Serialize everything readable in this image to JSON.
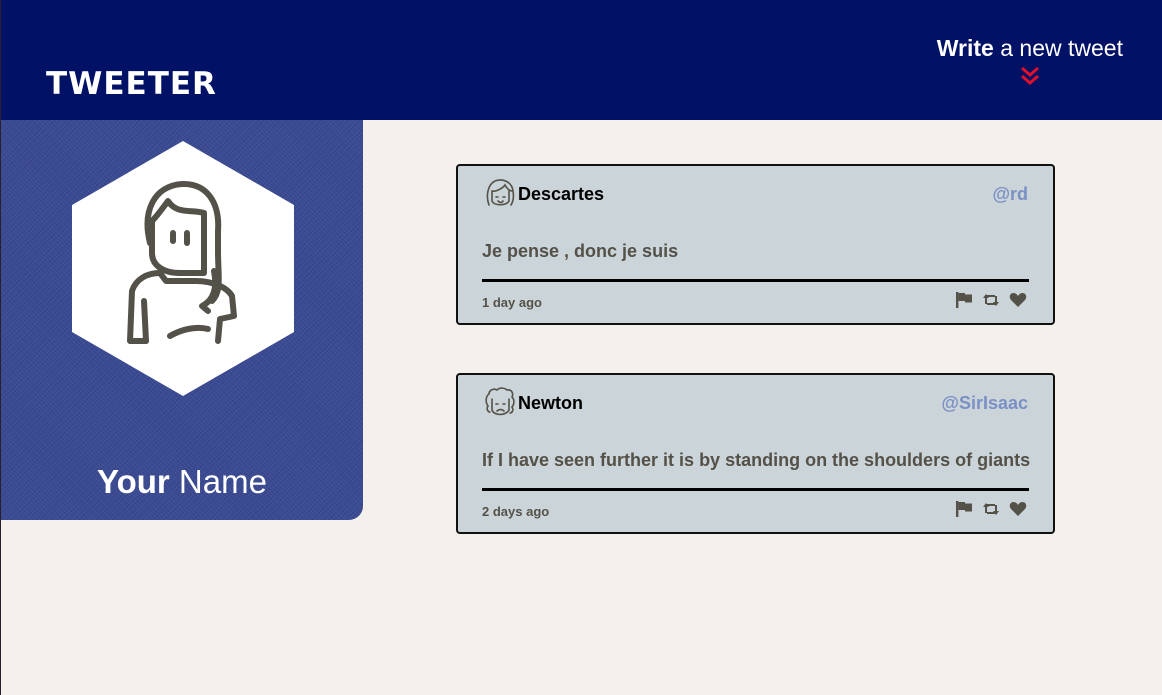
{
  "header": {
    "brand": "TWEETER",
    "compose_bold": "Write",
    "compose_rest": " a new tweet",
    "compose_icon": "double-chevron-down-icon"
  },
  "profile": {
    "name_bold": "Your",
    "name_rest": " Name",
    "avatar_icon": "user-avatar-icon"
  },
  "tweets": [
    {
      "name": "Descartes",
      "handle": "@rd",
      "text": "Je pense , donc je suis",
      "time": "1 day ago",
      "avatar_icon": "descartes-avatar-icon"
    },
    {
      "name": "Newton",
      "handle": "@SirIsaac",
      "text": "If I have seen further it is by standing on the shoulders of giants",
      "time": "2 days ago",
      "avatar_icon": "newton-avatar-icon"
    }
  ],
  "actions": [
    "flag-icon",
    "retweet-icon",
    "heart-icon"
  ],
  "colors": {
    "nav_bg": "#001166",
    "profile_bg": "#3a4a92",
    "page_bg": "#f4f1ec",
    "tweet_bg": "#cbd4d8",
    "handle": "#7b90c4",
    "accent_red": "#e0102a"
  }
}
